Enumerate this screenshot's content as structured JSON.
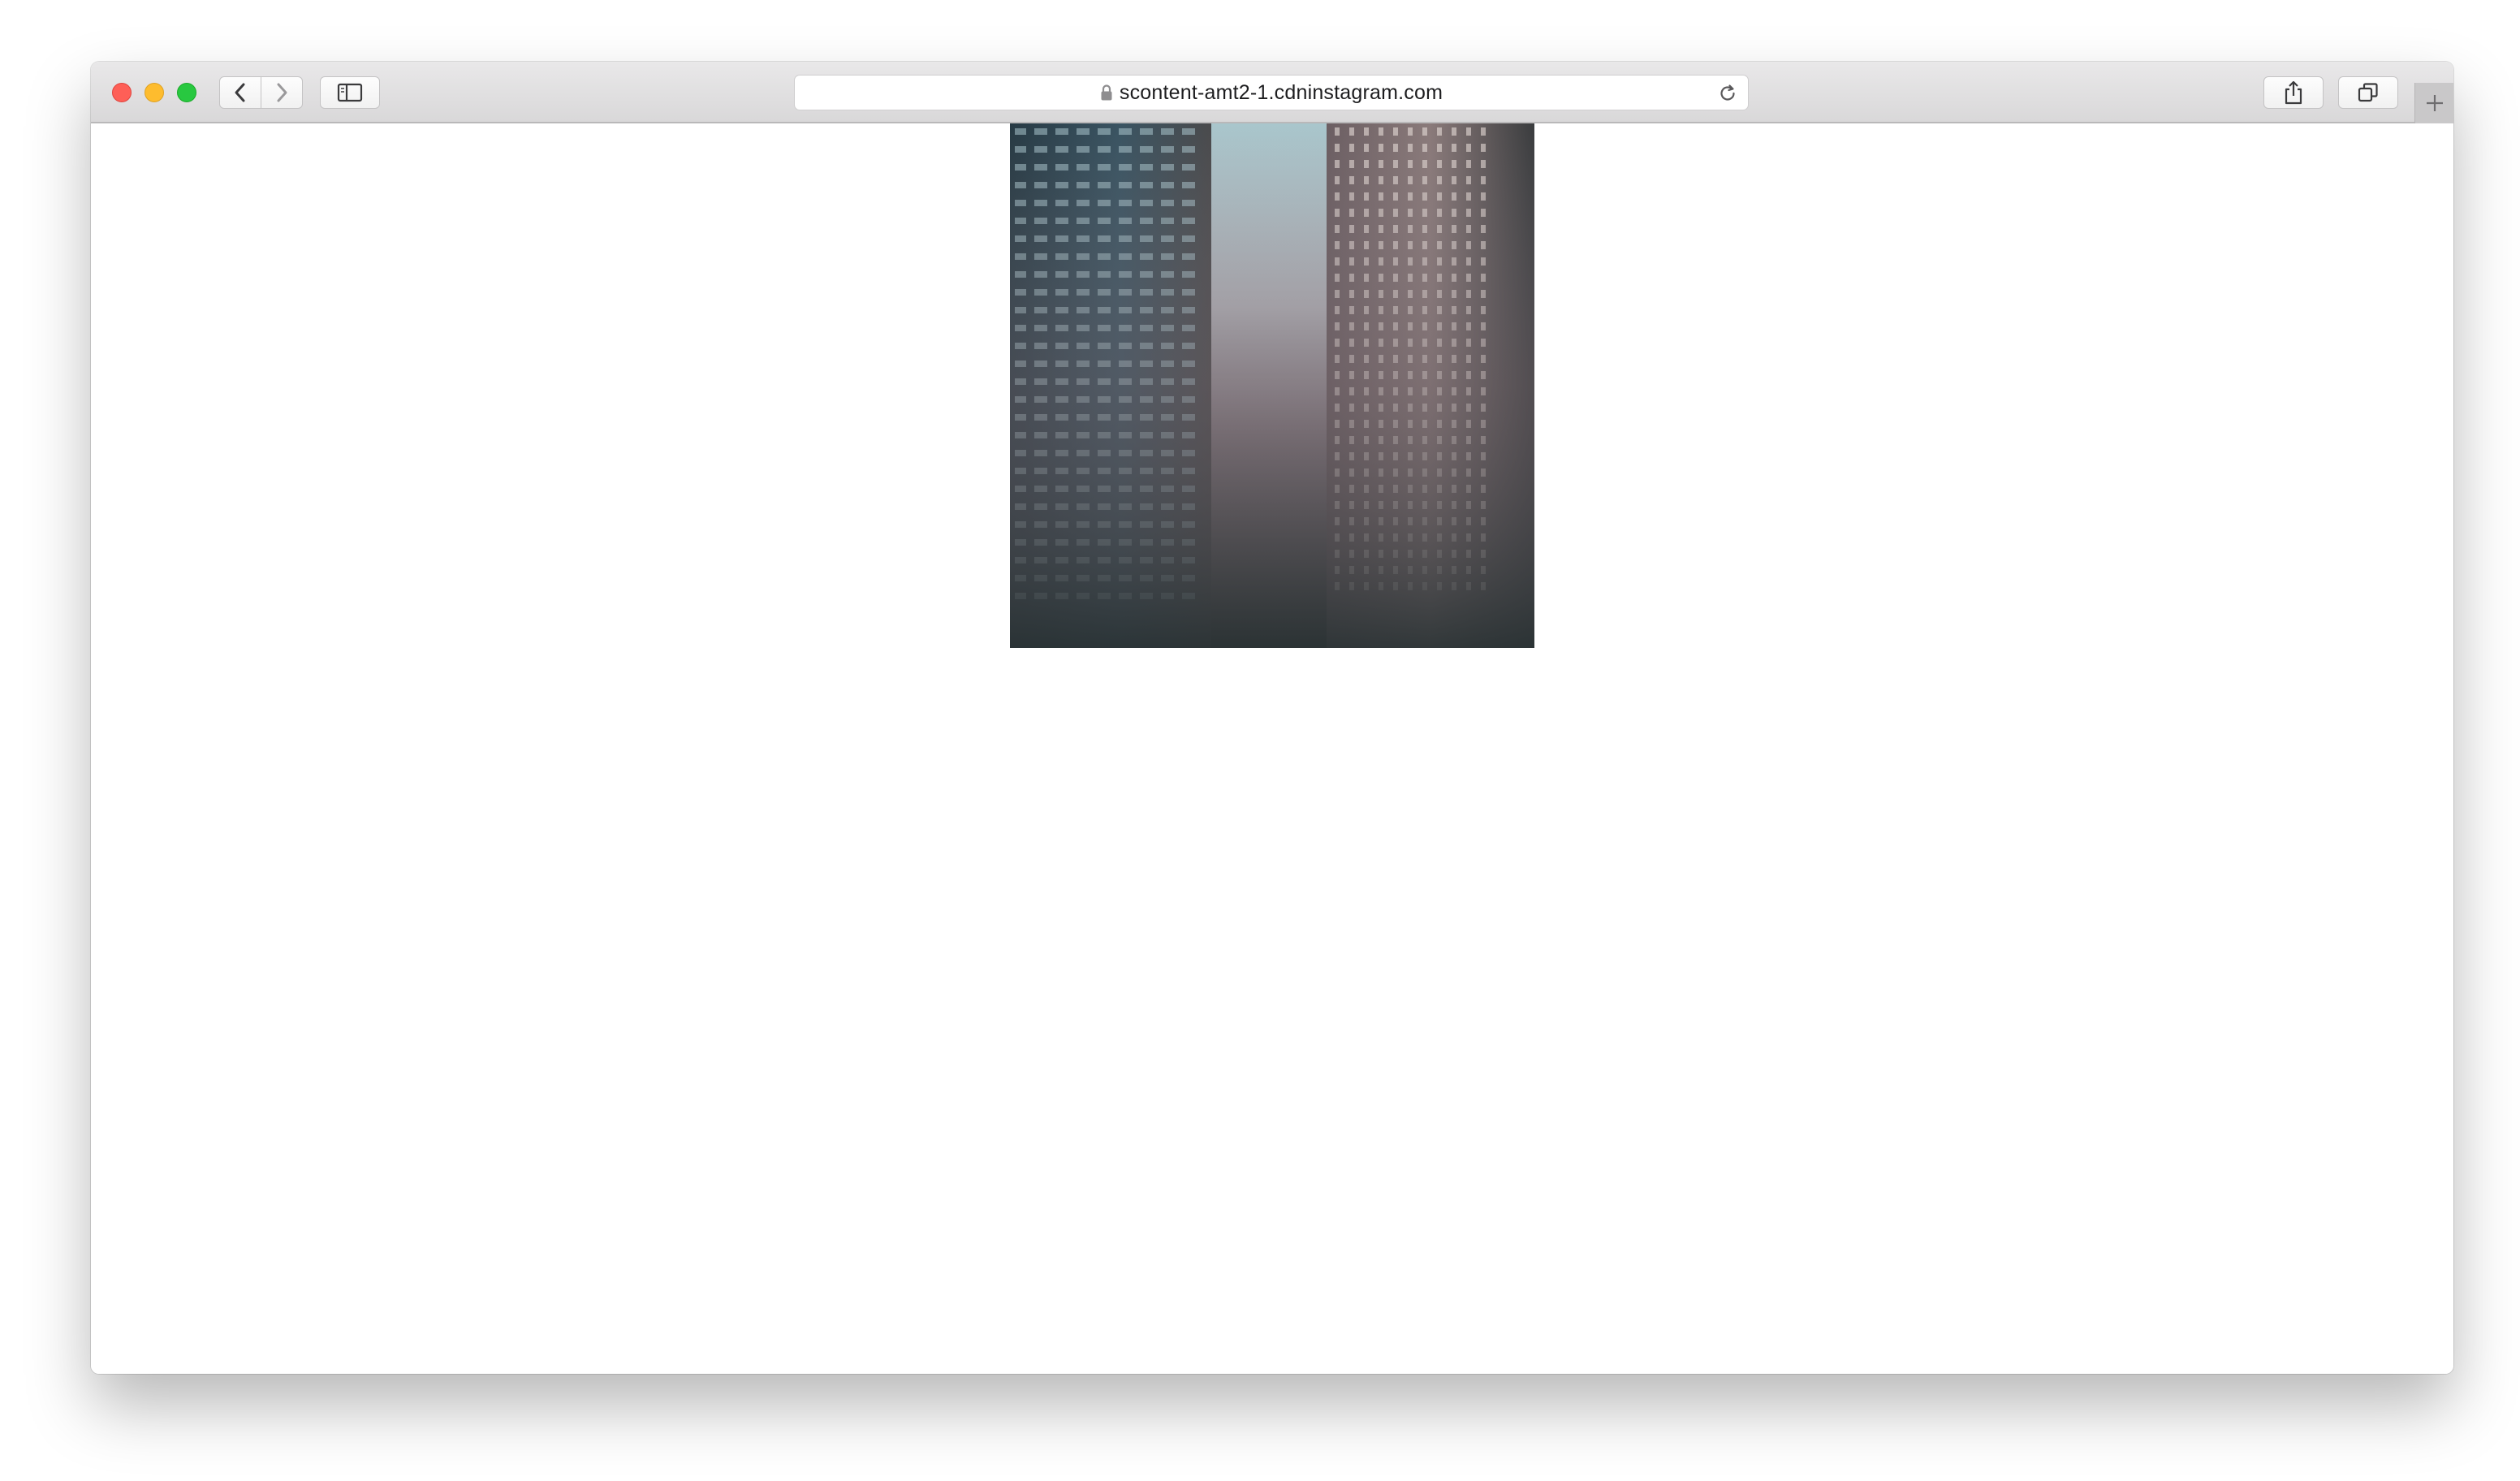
{
  "window": {
    "traffic_lights": [
      "close",
      "minimize",
      "maximize"
    ],
    "colors": {
      "close": "#fe5f57",
      "minimize": "#febc2e",
      "maximize": "#28c840"
    }
  },
  "toolbar": {
    "back_icon": "chevron-left-icon",
    "forward_icon": "chevron-right-icon",
    "sidebar_icon": "sidebar-icon",
    "share_icon": "share-icon",
    "tabs_icon": "tab-overview-icon",
    "new_tab_icon": "plus-icon"
  },
  "address_bar": {
    "url": "scontent-amt2-1.cdninstagram.com",
    "secure_icon": "lock-icon",
    "reload_icon": "reload-icon"
  },
  "content": {
    "image": "photo of foggy high-rise apartment towers"
  }
}
